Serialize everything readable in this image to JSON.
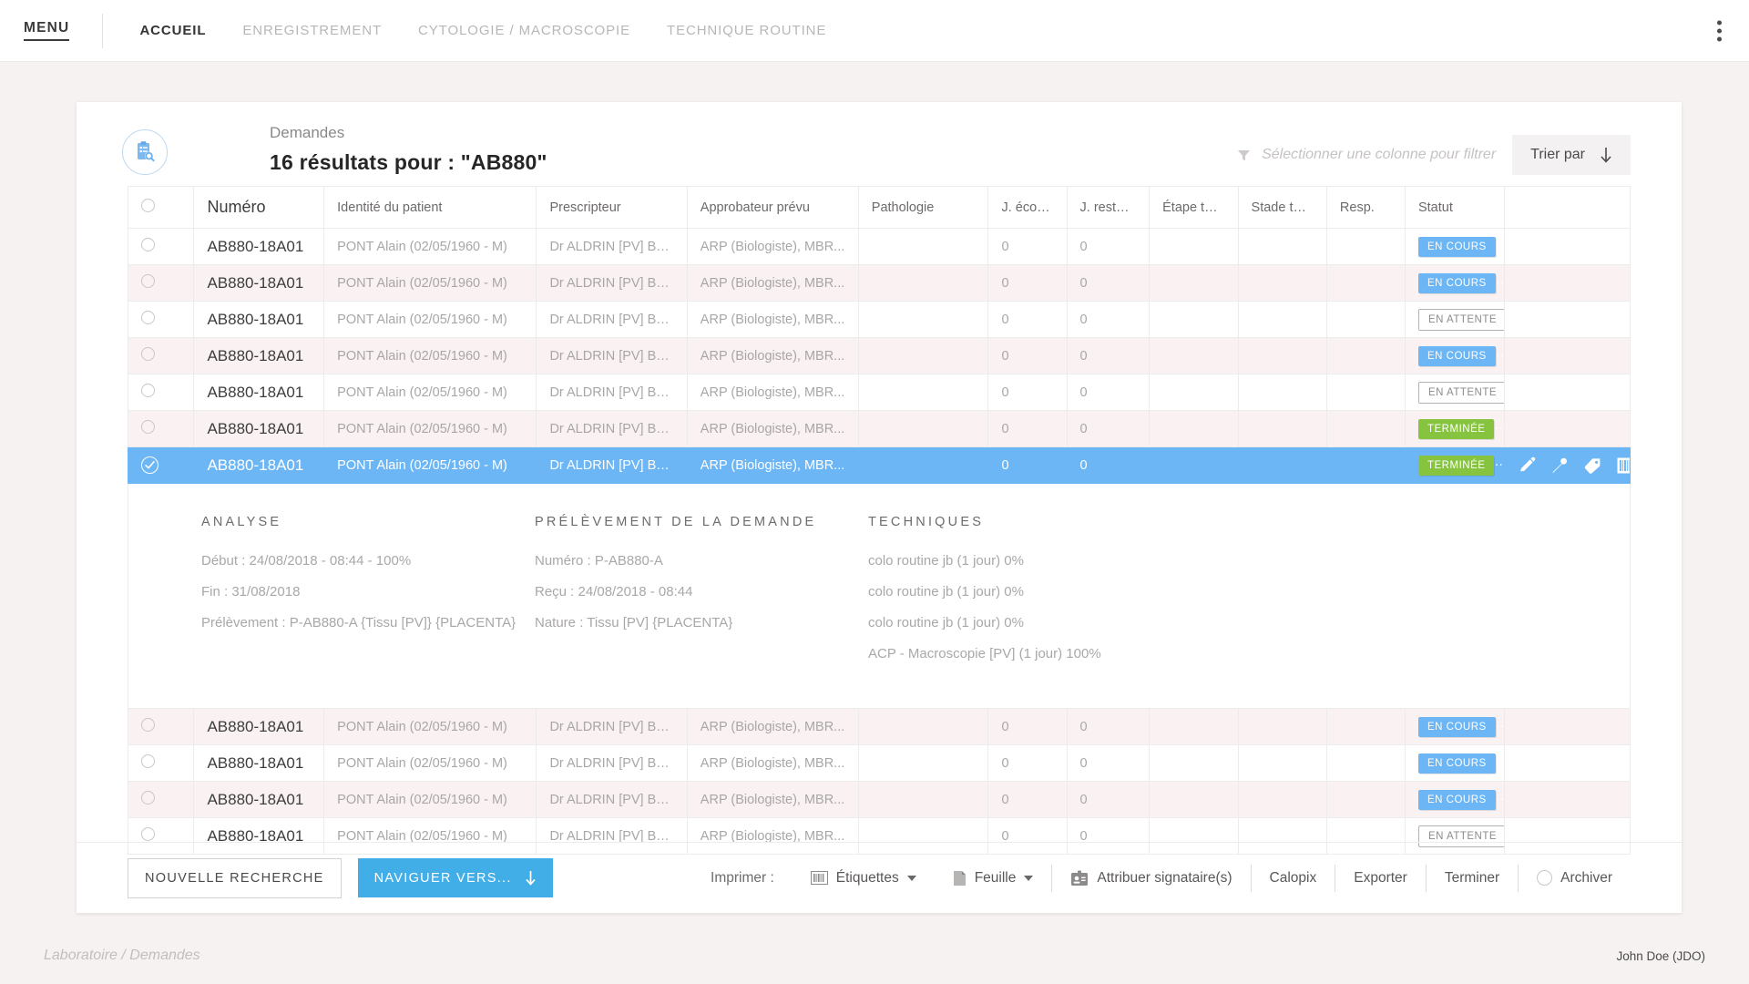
{
  "nav": {
    "menu_label": "MENU",
    "items": [
      {
        "label": "ACCUEIL",
        "active": true
      },
      {
        "label": "ENREGISTREMENT",
        "active": false
      },
      {
        "label": "CYTOLOGIE / MACROSCOPIE",
        "active": false
      },
      {
        "label": "TECHNIQUE ROUTINE",
        "active": false
      }
    ]
  },
  "header": {
    "subtitle": "Demandes",
    "title": "16 résultats pour : \"AB880\"",
    "filter_placeholder": "Sélectionner une colonne pour filtrer",
    "sort_label": "Trier par"
  },
  "table": {
    "columns": [
      "Numéro",
      "Identité du patient",
      "Prescripteur",
      "Approbateur prévu",
      "Pathologie",
      "J. écoulés",
      "J. restants",
      "Étape tech.",
      "Stade tech.",
      "Resp.",
      "Statut"
    ],
    "rows": [
      {
        "numero": "AB880-18A01",
        "patient": "PONT Alain (02/05/1960 - M)",
        "prescripteur": "Dr ALDRIN [PV] Buzz",
        "approbateur": "ARP (Biologiste), MBR...",
        "pathologie": "",
        "ecoules": "0",
        "restants": "0",
        "etape": "",
        "stade": "",
        "resp": "",
        "statut": "EN COURS",
        "statut_type": "blue",
        "alt": false,
        "selected": false
      },
      {
        "numero": "AB880-18A01",
        "patient": "PONT Alain (02/05/1960 - M)",
        "prescripteur": "Dr ALDRIN [PV] Buzz",
        "approbateur": "ARP (Biologiste), MBR...",
        "pathologie": "",
        "ecoules": "0",
        "restants": "0",
        "etape": "",
        "stade": "",
        "resp": "",
        "statut": "EN COURS",
        "statut_type": "blue",
        "alt": true,
        "selected": false
      },
      {
        "numero": "AB880-18A01",
        "patient": "PONT Alain (02/05/1960 - M)",
        "prescripteur": "Dr ALDRIN [PV] Buzz",
        "approbateur": "ARP (Biologiste), MBR...",
        "pathologie": "",
        "ecoules": "0",
        "restants": "0",
        "etape": "",
        "stade": "",
        "resp": "",
        "statut": "EN ATTENTE",
        "statut_type": "wait",
        "alt": false,
        "selected": false
      },
      {
        "numero": "AB880-18A01",
        "patient": "PONT Alain (02/05/1960 - M)",
        "prescripteur": "Dr ALDRIN [PV] Buzz",
        "approbateur": "ARP (Biologiste), MBR...",
        "pathologie": "",
        "ecoules": "0",
        "restants": "0",
        "etape": "",
        "stade": "",
        "resp": "",
        "statut": "EN COURS",
        "statut_type": "blue",
        "alt": true,
        "selected": false
      },
      {
        "numero": "AB880-18A01",
        "patient": "PONT Alain (02/05/1960 - M)",
        "prescripteur": "Dr ALDRIN [PV] Buzz",
        "approbateur": "ARP (Biologiste), MBR...",
        "pathologie": "",
        "ecoules": "0",
        "restants": "0",
        "etape": "",
        "stade": "",
        "resp": "",
        "statut": "EN ATTENTE",
        "statut_type": "wait",
        "alt": false,
        "selected": false
      },
      {
        "numero": "AB880-18A01",
        "patient": "PONT Alain (02/05/1960 - M)",
        "prescripteur": "Dr ALDRIN [PV] Buzz",
        "approbateur": "ARP (Biologiste), MBR...",
        "pathologie": "",
        "ecoules": "0",
        "restants": "0",
        "etape": "",
        "stade": "",
        "resp": "",
        "statut": "TERMINÉE",
        "statut_type": "green",
        "alt": true,
        "selected": false
      },
      {
        "numero": "AB880-18A01",
        "patient": "PONT Alain (02/05/1960 - M)",
        "prescripteur": "Dr ALDRIN [PV] Buzz",
        "approbateur": "ARP (Biologiste), MBR...",
        "pathologie": "",
        "ecoules": "0",
        "restants": "0",
        "etape": "",
        "stade": "",
        "resp": "",
        "statut": "TERMINÉE",
        "statut_type": "green",
        "alt": false,
        "selected": true
      },
      {
        "numero": "AB880-18A01",
        "patient": "PONT Alain (02/05/1960 - M)",
        "prescripteur": "Dr ALDRIN [PV] Buzz",
        "approbateur": "ARP (Biologiste), MBR...",
        "pathologie": "",
        "ecoules": "0",
        "restants": "0",
        "etape": "",
        "stade": "",
        "resp": "",
        "statut": "EN COURS",
        "statut_type": "blue",
        "alt": true,
        "selected": false
      },
      {
        "numero": "AB880-18A01",
        "patient": "PONT Alain (02/05/1960 - M)",
        "prescripteur": "Dr ALDRIN [PV] Buzz",
        "approbateur": "ARP (Biologiste), MBR...",
        "pathologie": "",
        "ecoules": "0",
        "restants": "0",
        "etape": "",
        "stade": "",
        "resp": "",
        "statut": "EN COURS",
        "statut_type": "blue",
        "alt": false,
        "selected": false
      },
      {
        "numero": "AB880-18A01",
        "patient": "PONT Alain (02/05/1960 - M)",
        "prescripteur": "Dr ALDRIN [PV] Buzz",
        "approbateur": "ARP (Biologiste), MBR...",
        "pathologie": "",
        "ecoules": "0",
        "restants": "0",
        "etape": "",
        "stade": "",
        "resp": "",
        "statut": "EN COURS",
        "statut_type": "blue",
        "alt": true,
        "selected": false
      },
      {
        "numero": "AB880-18A01",
        "patient": "PONT Alain (02/05/1960 - M)",
        "prescripteur": "Dr ALDRIN [PV] Buzz",
        "approbateur": "ARP (Biologiste), MBR...",
        "pathologie": "",
        "ecoules": "0",
        "restants": "0",
        "etape": "",
        "stade": "",
        "resp": "",
        "statut": "EN ATTENTE",
        "statut_type": "wait",
        "alt": false,
        "selected": false
      }
    ],
    "row_actions": [
      "pencil-icon",
      "pipette-icon",
      "tag-icon",
      "barcode-icon"
    ]
  },
  "detail": {
    "analyse": {
      "title": "ANALYSE",
      "lines": [
        "Début : 24/08/2018 - 08:44 - 100%",
        "Fin : 31/08/2018",
        "Prélèvement : P-AB880-A {Tissu [PV]} {PLACENTA}"
      ]
    },
    "prelevement": {
      "title": "PRÉLÈVEMENT DE LA DEMANDE",
      "lines": [
        "Numéro : P-AB880-A",
        "Reçu : 24/08/2018 - 08:44",
        "Nature : Tissu [PV] {PLACENTA}"
      ]
    },
    "techniques": {
      "title": "TECHNIQUES",
      "lines": [
        "colo routine jb (1 jour) 0%",
        "colo routine jb (1 jour) 0%",
        "colo routine jb (1 jour) 0%",
        "ACP - Macroscopie [PV] (1 jour) 100%"
      ]
    }
  },
  "bottom": {
    "new_search": "NOUVELLE RECHERCHE",
    "navigate": "NAVIGUER VERS...",
    "print_label": "Imprimer :",
    "labels_btn": "Étiquettes",
    "sheet_btn": "Feuille",
    "assign_signers": "Attribuer signataire(s)",
    "calopix": "Calopix",
    "export": "Exporter",
    "finish": "Terminer",
    "archive": "Archiver"
  },
  "footer": {
    "breadcrumb": "Laboratoire / Demandes",
    "user": "John Doe (JDO)"
  },
  "colors": {
    "accent_blue": "#6cb6f5",
    "button_blue": "#42aee8",
    "green": "#86c440",
    "alt_row": "#faf2f2",
    "page_bg": "#f7f2f2"
  }
}
